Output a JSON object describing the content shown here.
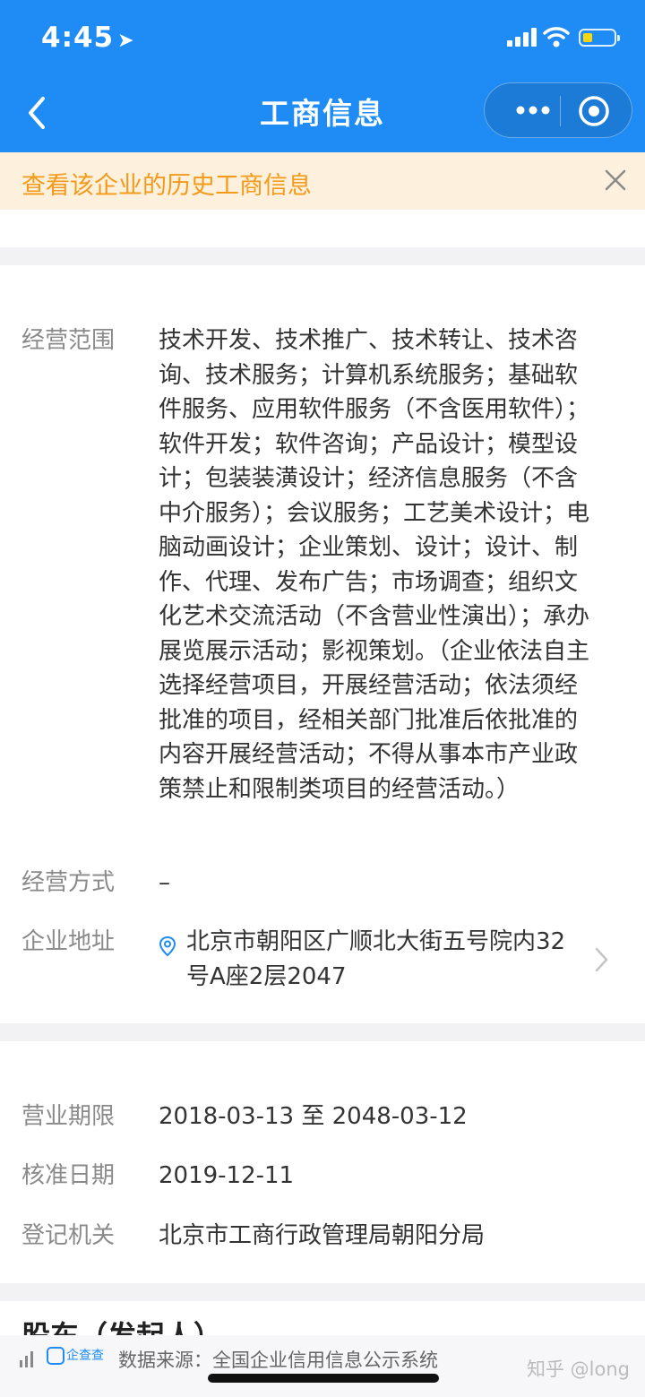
{
  "status": {
    "time": "4:45"
  },
  "nav": {
    "title": "工商信息"
  },
  "banner": {
    "text": "查看该企业的历史工商信息"
  },
  "info": {
    "scope": {
      "label": "经营范围",
      "value": "技术开发、技术推广、技术转让、技术咨询、技术服务；计算机系统服务；基础软件服务、应用软件服务（不含医用软件）；软件开发；软件咨询；产品设计；模型设计；包装装潢设计；经济信息服务（不含中介服务）；会议服务；工艺美术设计；电脑动画设计；企业策划、设计；设计、制作、代理、发布广告；市场调查；组织文化艺术交流活动（不含营业性演出）；承办展览展示活动；影视策划。（企业依法自主选择经营项目，开展经营活动；依法须经批准的项目，经相关部门批准后依批准的内容开展经营活动；不得从事本市产业政策禁止和限制类项目的经营活动。）"
    },
    "mode": {
      "label": "经营方式",
      "value": "–"
    },
    "address": {
      "label": "企业地址",
      "value": "北京市朝阳区广顺北大街五号院内32号A座2层2047"
    },
    "period": {
      "label": "营业期限",
      "value": "2018-03-13 至 2048-03-12"
    },
    "approval": {
      "label": "核准日期",
      "value": "2019-12-11"
    },
    "authority": {
      "label": "登记机关",
      "value": "北京市工商行政管理局朝阳分局"
    }
  },
  "next_section": {
    "title": "股东（发起人）"
  },
  "footer": {
    "logo_text": "企查查",
    "source": "数据来源：全国企业信用信息公示系统",
    "watermark": "知乎 @long"
  },
  "colors": {
    "nav_bg": "#1f8cf5",
    "banner_bg": "#fdf0dc",
    "banner_text": "#f39a1a"
  }
}
